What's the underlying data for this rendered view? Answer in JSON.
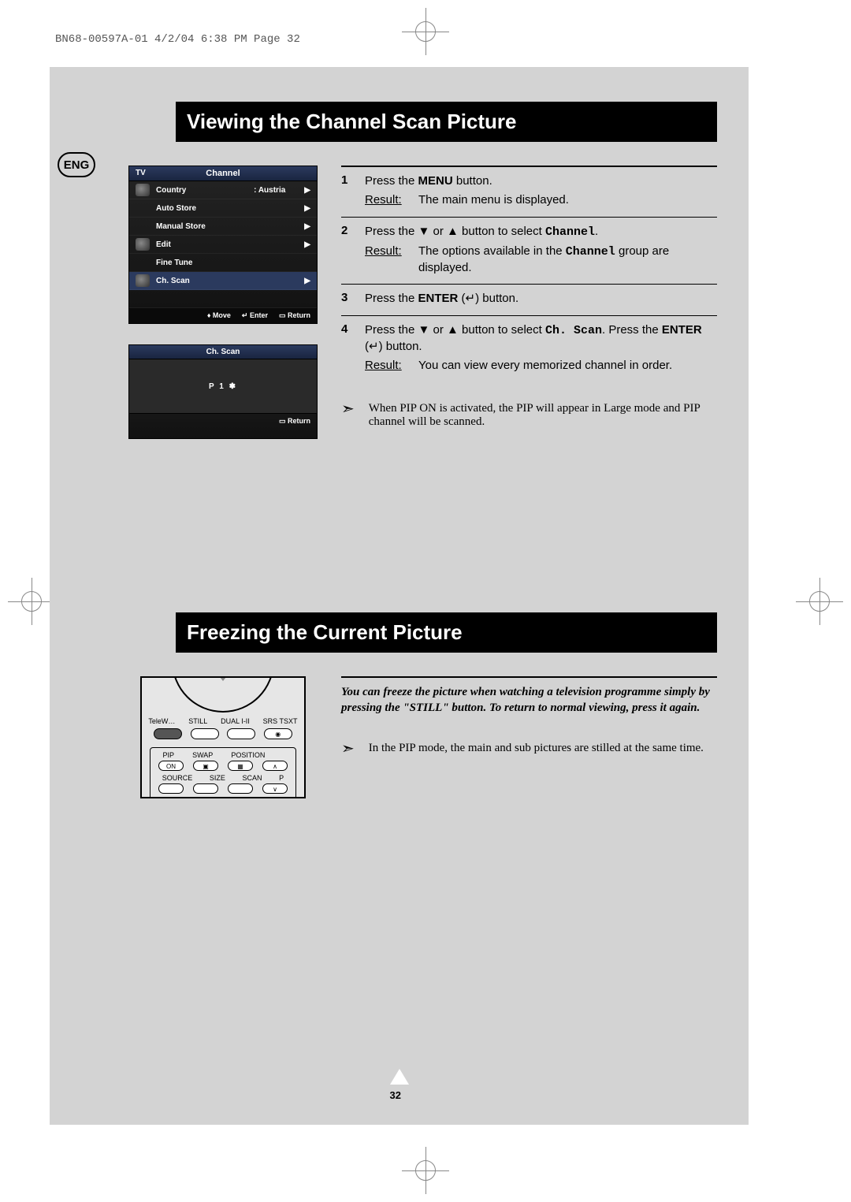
{
  "doc_header": "BN68-00597A-01  4/2/04  6:38 PM  Page 32",
  "lang_badge": "ENG",
  "section1": {
    "title": "Viewing the Channel Scan Picture",
    "osd_menu": {
      "tv_label": "TV",
      "header": "Channel",
      "rows": [
        {
          "label": "Country",
          "value": ": Austria"
        },
        {
          "label": "Auto Store",
          "value": ""
        },
        {
          "label": "Manual Store",
          "value": ""
        },
        {
          "label": "Edit",
          "value": ""
        },
        {
          "label": "Fine Tune",
          "value": ""
        },
        {
          "label": "Ch. Scan",
          "value": ""
        }
      ],
      "footer": {
        "move": "Move",
        "enter": "Enter",
        "return": "Return"
      }
    },
    "osd_scan": {
      "title": "Ch. Scan",
      "body": "P 1  ✽",
      "return": "Return"
    },
    "steps": [
      {
        "num": "1",
        "line1_a": "Press the ",
        "line1_bold": "MENU",
        "line1_b": " button.",
        "result_label": "Result",
        "result_text": "The main menu is displayed."
      },
      {
        "num": "2",
        "line1_a": "Press the ▼ or ▲ button to select ",
        "line1_mono": "Channel",
        "line1_b": ".",
        "result_label": "Result",
        "result_text_a": "The options available in the ",
        "result_mono": "Channel",
        "result_text_b": " group are displayed."
      },
      {
        "num": "3",
        "line1_a": "Press the ",
        "line1_bold": "ENTER",
        "line1_b": " (↵) button."
      },
      {
        "num": "4",
        "line1_a": "Press the ▼ or ▲ button to select ",
        "line1_mono": "Ch. Scan",
        "line1_b": ". Press the ",
        "line1_bold": "ENTER",
        "line1_c": " (↵) button.",
        "result_label": "Result",
        "result_text": "You can view every memorized channel in order."
      }
    ],
    "note": "When PIP ON is activated, the PIP will appear in Large mode and PIP channel will be scanned."
  },
  "section2": {
    "title": "Freezing the Current Picture",
    "intro": "You can freeze the picture when watching a television programme simply by pressing the \"STILL\" button. To return to normal viewing, press it again.",
    "note": "In the PIP mode, the main and sub pictures are stilled at the same time.",
    "remote": {
      "row1_labels": [
        "TeleW…",
        "STILL",
        "DUAL I-II",
        "SRS TSXT"
      ],
      "row2_labels": [
        "PIP",
        "SWAP",
        "POSITION",
        ""
      ],
      "row2_btn1": "ON",
      "row3_labels": [
        "SOURCE",
        "SIZE",
        "SCAN",
        "P"
      ]
    }
  },
  "page_number": "32"
}
